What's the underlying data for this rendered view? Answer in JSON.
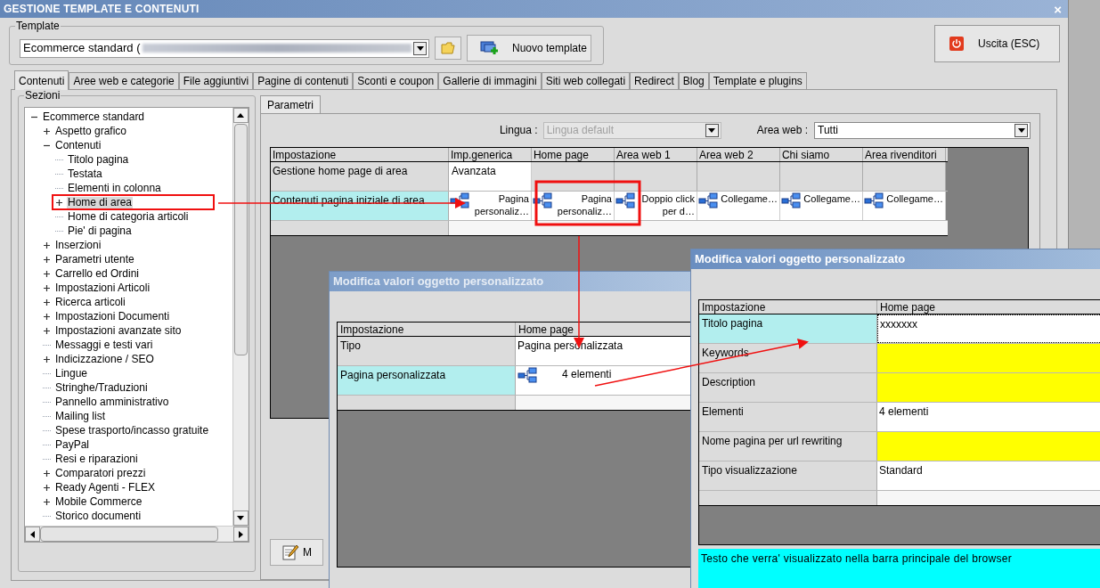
{
  "window": {
    "title": "GESTIONE TEMPLATE E CONTENUTI",
    "close": "×"
  },
  "template": {
    "label": "Template",
    "value": "Ecommerce standard (",
    "new_button": "Nuovo template"
  },
  "exit_button": "Uscita (ESC)",
  "tabs": [
    {
      "label": "Contenuti",
      "selected": true
    },
    {
      "label": "Aree web e categorie",
      "selected": false
    },
    {
      "label": "File aggiuntivi",
      "selected": false
    },
    {
      "label": "Pagine di contenuti",
      "selected": false
    },
    {
      "label": "Sconti e coupon",
      "selected": false
    },
    {
      "label": "Gallerie di immagini",
      "selected": false
    },
    {
      "label": "Siti web collegati",
      "selected": false
    },
    {
      "label": "Redirect",
      "selected": false
    },
    {
      "label": "Blog",
      "selected": false
    },
    {
      "label": "Template e plugins",
      "selected": false
    }
  ],
  "sections": {
    "label": "Sezioni",
    "tree": [
      {
        "label": "Ecommerce standard",
        "expanded": true,
        "selected": false,
        "children": [
          {
            "label": "Aspetto grafico",
            "expanded": false,
            "selected": false
          },
          {
            "label": "Contenuti",
            "expanded": true,
            "selected": false,
            "children": [
              {
                "label": "Titolo pagina",
                "selected": false
              },
              {
                "label": "Testata",
                "selected": false
              },
              {
                "label": "Elementi in colonna",
                "selected": false
              },
              {
                "label": "Home di area",
                "expanded": false,
                "selected": true
              },
              {
                "label": "Home di categoria articoli",
                "selected": false
              },
              {
                "label": "Pie' di pagina",
                "selected": false
              }
            ]
          },
          {
            "label": "Inserzioni",
            "expanded": false,
            "selected": false
          },
          {
            "label": "Parametri utente",
            "expanded": false,
            "selected": false
          },
          {
            "label": "Carrello ed Ordini",
            "expanded": false,
            "selected": false
          },
          {
            "label": "Impostazioni Articoli",
            "expanded": false,
            "selected": false
          },
          {
            "label": "Ricerca articoli",
            "expanded": false,
            "selected": false
          },
          {
            "label": "Impostazioni Documenti",
            "expanded": false,
            "selected": false
          },
          {
            "label": "Impostazioni avanzate sito",
            "expanded": false,
            "selected": false
          },
          {
            "label": "Messaggi e testi vari",
            "selected": false
          },
          {
            "label": "Indicizzazione / SEO",
            "expanded": false,
            "selected": false
          },
          {
            "label": "Lingue",
            "selected": false
          },
          {
            "label": "Stringhe/Traduzioni",
            "selected": false
          },
          {
            "label": "Pannello amministrativo",
            "selected": false
          },
          {
            "label": "Mailing list",
            "selected": false
          },
          {
            "label": "Spese trasporto/incasso gratuite",
            "selected": false
          },
          {
            "label": "PayPal",
            "selected": false
          },
          {
            "label": "Resi e riparazioni",
            "selected": false
          },
          {
            "label": "Comparatori prezzi",
            "expanded": false,
            "selected": false
          },
          {
            "label": "Ready Agenti - FLEX",
            "expanded": false,
            "selected": false
          },
          {
            "label": "Mobile Commerce",
            "expanded": false,
            "selected": false
          },
          {
            "label": "Storico documenti",
            "selected": false
          }
        ]
      }
    ]
  },
  "params": {
    "tab": "Parametri",
    "language_label": "Lingua :",
    "language_value": "Lingua default",
    "language_disabled": true,
    "area_label": "Area web :",
    "area_value": "Tutti",
    "table": {
      "columns": [
        "Impostazione",
        "Imp.generica",
        "Home page",
        "Area web 1",
        "Area web 2",
        "Chi siamo",
        "Area rivenditori"
      ],
      "rows": [
        {
          "selected": false,
          "cells": [
            {
              "kind": "label",
              "text": "Gestione home page di area"
            },
            {
              "kind": "text",
              "text": "Avanzata"
            },
            {
              "kind": "empty"
            },
            {
              "kind": "empty"
            },
            {
              "kind": "empty"
            },
            {
              "kind": "empty"
            },
            {
              "kind": "empty"
            }
          ]
        },
        {
          "selected": true,
          "cells": [
            {
              "kind": "label",
              "text": "Contenuti pagina iniziale di area"
            },
            {
              "kind": "object",
              "text": "Pagina personaliz…"
            },
            {
              "kind": "object",
              "text": "Pagina personaliz…"
            },
            {
              "kind": "object",
              "text": "Doppio click per d…"
            },
            {
              "kind": "object",
              "text": "Collegame…"
            },
            {
              "kind": "object",
              "text": "Collegame…"
            },
            {
              "kind": "object",
              "text": "Collegame…"
            }
          ]
        }
      ]
    }
  },
  "bottom_button": "M",
  "dialogs": [
    {
      "title": "Modifica valori oggetto personalizzato",
      "active": false,
      "columns": [
        "Impostazione",
        "Home page"
      ],
      "rows": [
        {
          "label": "Tipo",
          "selected": false,
          "value": {
            "kind": "text",
            "text": "Pagina personalizzata",
            "required": false
          }
        },
        {
          "label": "Pagina personalizzata",
          "selected": true,
          "value": {
            "kind": "object",
            "text": "4 elementi",
            "required": false
          }
        }
      ]
    },
    {
      "title": "Modifica valori oggetto personalizzato",
      "active": true,
      "columns": [
        "Impostazione",
        "Home page"
      ],
      "rows": [
        {
          "label": "Titolo pagina",
          "selected": true,
          "value": {
            "kind": "text",
            "text": "xxxxxxx",
            "required": false
          }
        },
        {
          "label": "Keywords",
          "selected": false,
          "value": {
            "kind": "text",
            "required": true
          }
        },
        {
          "label": "Description",
          "selected": false,
          "value": {
            "kind": "text",
            "required": true
          }
        },
        {
          "label": "Elementi",
          "selected": false,
          "value": {
            "kind": "text",
            "text": "4 elementi",
            "required": false
          }
        },
        {
          "label": "Nome pagina per url rewriting",
          "selected": false,
          "value": {
            "kind": "text",
            "required": true
          }
        },
        {
          "label": "Tipo visualizzazione",
          "selected": false,
          "value": {
            "kind": "text",
            "text": "Standard",
            "required": false
          }
        }
      ],
      "hint": "Testo che verra' visualizzato nella barra principale del browser"
    }
  ]
}
